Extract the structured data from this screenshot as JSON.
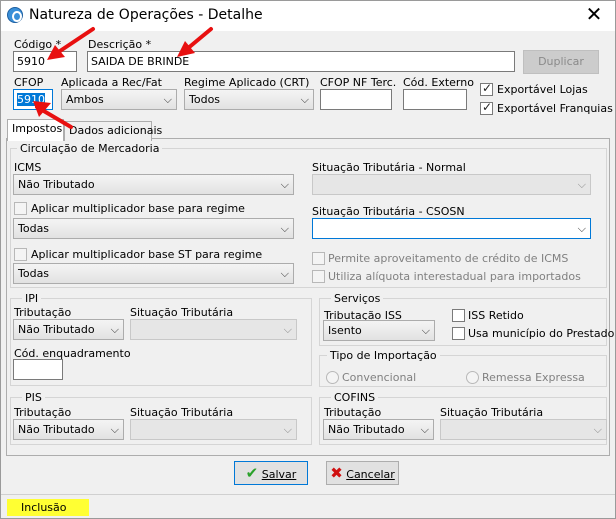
{
  "window": {
    "title": "Natureza de Operações - Detalhe"
  },
  "header": {
    "codigo_label": "Código *",
    "codigo_value": "5910",
    "descricao_label": "Descrição *",
    "descricao_value": "SAIDA DE BRINDE",
    "duplicar_label": "Duplicar",
    "cfop_label": "CFOP",
    "cfop_value": "5910",
    "aplicada_label": "Aplicada a Rec/Fat",
    "aplicada_value": "Ambos",
    "regime_label": "Regime Aplicado (CRT)",
    "regime_value": "Todos",
    "cfop_nf_label": "CFOP NF Terc.",
    "cfop_nf_value": "",
    "cod_externo_label": "Cód. Externo",
    "cod_externo_value": "",
    "exportavel_lojas_label": "Exportável Lojas",
    "exportavel_lojas_checked": true,
    "exportavel_franquias_label": "Exportável Franquias",
    "exportavel_franquias_checked": true
  },
  "tabs": [
    {
      "label": "Impostos",
      "active": true
    },
    {
      "label": "Dados adicionais",
      "active": false
    }
  ],
  "circulacao": {
    "legend": "Circulação de Mercadoria",
    "icms_label": "ICMS",
    "icms_value": "Não Tributado",
    "aplicar_mult_label": "Aplicar multiplicador base para regime",
    "aplicar_mult_value": "Todas",
    "aplicar_mult_st_label": "Aplicar multiplicador base ST para regime",
    "aplicar_mult_st_value": "Todas",
    "sit_normal_label": "Situação Tributária - Normal",
    "sit_normal_value": "",
    "sit_csosn_label": "Situação Tributária - CSOSN",
    "sit_csosn_value": "",
    "permite_credito_label": "Permite aproveitamento de crédito de ICMS",
    "utiliza_aliquota_label": "Utiliza alíquota interestadual para importados"
  },
  "ipi": {
    "legend": "IPI",
    "tributacao_label": "Tributação",
    "tributacao_value": "Não Tributado",
    "situacao_label": "Situação Tributária",
    "situacao_value": "",
    "cod_enquadramento_label": "Cód. enquadramento",
    "cod_enquadramento_value": ""
  },
  "servicos": {
    "legend": "Serviços",
    "tributacao_iss_label": "Tributação ISS",
    "tributacao_iss_value": "Isento",
    "iss_retido_label": "ISS Retido",
    "usa_municipio_label": "Usa município do Prestador"
  },
  "importacao": {
    "legend": "Tipo de Importação",
    "convencional_label": "Convencional",
    "remessa_label": "Remessa Expressa"
  },
  "pis": {
    "legend": "PIS",
    "tributacao_label": "Tributação",
    "tributacao_value": "Não Tributado",
    "situacao_label": "Situação Tributária",
    "situacao_value": ""
  },
  "cofins": {
    "legend": "COFINS",
    "tributacao_label": "Tributação",
    "tributacao_value": "Não Tributado",
    "situacao_label": "Situação Tributária",
    "situacao_value": ""
  },
  "footer": {
    "salvar_label": "Salvar",
    "cancelar_label": "Cancelar"
  },
  "status": {
    "mode": "Inclusão"
  },
  "colors": {
    "accent_blue": "#0078d7",
    "annotation_red": "#e81010",
    "status_yellow": "#ffff33",
    "salvar_check": "#2aa12a",
    "cancelar_x": "#d01010"
  },
  "icons": [
    "app-icon",
    "close-icon",
    "chevron-down-icon",
    "checkmark-icon",
    "cancel-x-icon",
    "annotation-arrow"
  ]
}
